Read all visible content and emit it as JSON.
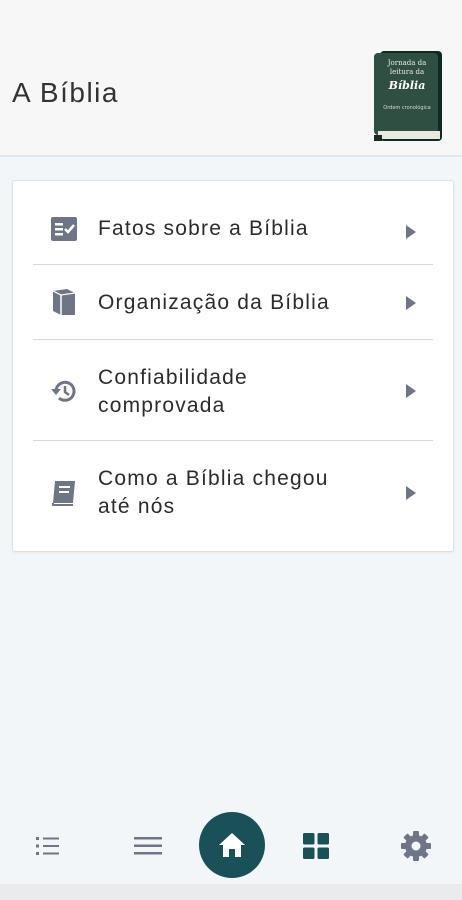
{
  "header": {
    "title": "A Bíblia",
    "book_cover": {
      "line1": "Jornada da",
      "line2": "leitura da",
      "line3": "Bíblia",
      "line4": "Ordem cronológica"
    }
  },
  "menu": {
    "items": [
      {
        "label": "Fatos sobre a Bíblia",
        "icon": "checklist-icon"
      },
      {
        "label": "Organização da Bíblia",
        "icon": "book-icon"
      },
      {
        "label": "Confiabilidade comprovada",
        "icon": "history-icon"
      },
      {
        "label": "Como a Bíblia chegou até nós",
        "icon": "open-book-icon"
      }
    ]
  },
  "bottom_nav": {
    "items": [
      {
        "icon": "list-bullets-icon"
      },
      {
        "icon": "menu-icon"
      },
      {
        "icon": "home-icon",
        "active": true
      },
      {
        "icon": "grid-icon"
      },
      {
        "icon": "gear-icon"
      }
    ]
  },
  "colors": {
    "accent": "#1a5057",
    "icon_gray": "#6e7587",
    "background": "#f3f6f9"
  }
}
